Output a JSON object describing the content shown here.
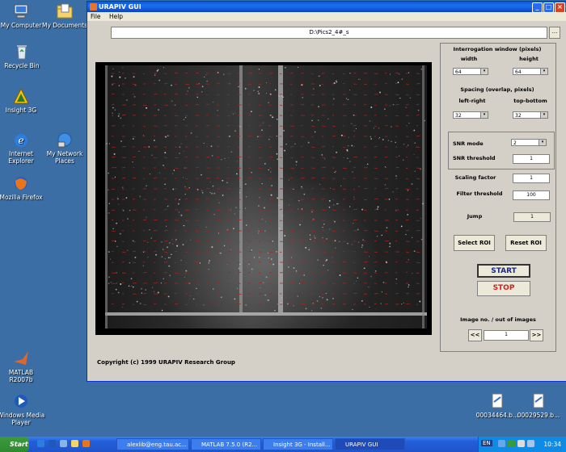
{
  "desktop": {
    "icons": [
      {
        "label": "My Computer",
        "icon": "computer-icon"
      },
      {
        "label": "My Documents",
        "icon": "documents-folder-icon"
      },
      {
        "label": "Recycle Bin",
        "icon": "recycle-bin-icon"
      },
      {
        "label": "Insight 3G",
        "icon": "insight-icon"
      },
      {
        "label": "Internet Explorer",
        "icon": "ie-icon"
      },
      {
        "label": "My Network Places",
        "icon": "network-icon"
      },
      {
        "label": "Mozilla Firefox",
        "icon": "firefox-icon"
      },
      {
        "label": "MATLAB R2007b",
        "icon": "matlab-icon"
      },
      {
        "label": "Windows Media Player",
        "icon": "media-player-icon"
      },
      {
        "label": "00034464.b...",
        "icon": "file-icon"
      },
      {
        "label": "00029529.b...",
        "icon": "file-icon"
      }
    ]
  },
  "window": {
    "title": "URAPIV GUI",
    "controls": [
      "_",
      "□",
      "×"
    ],
    "menu": [
      "File",
      "Help"
    ],
    "path": "D:\\Pics2_4#_s",
    "browse_label": "...",
    "copyright": "Copyright (c) 1999 URAPIV Research Group"
  },
  "panel": {
    "interrogation_title": "Interrogation window (pixels)",
    "width_label": "width",
    "height_label": "height",
    "width_value": "64",
    "height_value": "64",
    "spacing_title": "Spacing (overlap, pixels)",
    "left_right_label": "left-right",
    "top_bottom_label": "top-bottom",
    "left_right_value": "32",
    "top_bottom_value": "32",
    "snr_mode_label": "SNR mode",
    "snr_mode_value": "2",
    "snr_threshold_label": "SNR threshold",
    "snr_threshold_value": "1",
    "scaling_label": "Scaling factor",
    "scaling_value": "1",
    "filter_label": "Filter threshold",
    "filter_value": "100",
    "jump_label": "Jump",
    "jump_value": "1",
    "select_roi": "Select ROI",
    "reset_roi": "Reset ROI",
    "start": "START",
    "stop": "STOP",
    "image_no_label": "Image no. / out of images",
    "prev": "<<",
    "image_no_value": "1",
    "next": ">>"
  },
  "colors": {
    "start_text": "#1a2a8a",
    "stop_text": "#d02020",
    "vector_red": "#b02020"
  },
  "taskbar": {
    "start_label": "Start",
    "tasks": [
      {
        "label": "alexlib@eng.tau.ac...",
        "active": false
      },
      {
        "label": "MATLAB 7.5.0 (R2...",
        "active": false
      },
      {
        "label": "Insight 3G - Install...",
        "active": false
      },
      {
        "label": "URAPIV GUI",
        "active": true
      }
    ],
    "lang": "EN",
    "clock": "10:34"
  }
}
